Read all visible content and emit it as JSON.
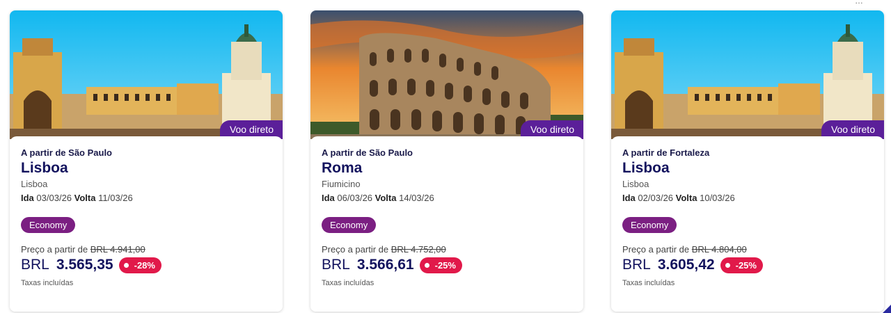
{
  "top_fragment": "…",
  "cards": [
    {
      "badge": "Voo direto",
      "origin": "A partir de São Paulo",
      "destination": "Lisboa",
      "airport": "Lisboa",
      "ida_label": "Ida",
      "ida_date": "03/03/26",
      "volta_label": "Volta",
      "volta_date": "11/03/26",
      "cabin": "Economy",
      "price_from_label": "Preço a partir de",
      "old_price": "BRL 4.941,00",
      "currency": "BRL",
      "price": "3.565,35",
      "discount": "-28%",
      "taxes": "Taxas incluídas"
    },
    {
      "badge": "Voo direto",
      "origin": "A partir de São Paulo",
      "destination": "Roma",
      "airport": "Fiumicino",
      "ida_label": "Ida",
      "ida_date": "06/03/26",
      "volta_label": "Volta",
      "volta_date": "14/03/26",
      "cabin": "Economy",
      "price_from_label": "Preço a partir de",
      "old_price": "BRL 4.752,00",
      "currency": "BRL",
      "price": "3.566,61",
      "discount": "-25%",
      "taxes": "Taxas incluídas"
    },
    {
      "badge": "Voo direto",
      "origin": "A partir de Fortaleza",
      "destination": "Lisboa",
      "airport": "Lisboa",
      "ida_label": "Ida",
      "ida_date": "02/03/26",
      "volta_label": "Volta",
      "volta_date": "10/03/26",
      "cabin": "Economy",
      "price_from_label": "Preço a partir de",
      "old_price": "BRL 4.804,00",
      "currency": "BRL",
      "price": "3.605,42",
      "discount": "-25%",
      "taxes": "Taxas incluídas"
    }
  ],
  "colors": {
    "badge": "#5b1f99",
    "cabin": "#7b1f82",
    "discount": "#e1194a",
    "title": "#13135e"
  }
}
